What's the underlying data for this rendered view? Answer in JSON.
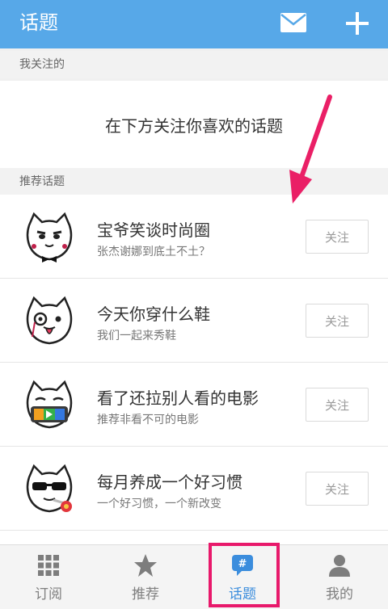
{
  "header": {
    "title": "话题",
    "mail_icon": "mail-icon",
    "add_icon": "plus-icon"
  },
  "following": {
    "label": "我关注的",
    "empty_message": "在下方关注你喜欢的话题"
  },
  "recommended": {
    "label": "推荐话题",
    "follow_label": "关注",
    "topics": [
      {
        "name": "宝爷笑谈时尚圈",
        "desc": "张杰谢娜到底土不土？",
        "avatar_icon": "cat-bowtie-avatar-icon"
      },
      {
        "name": "今天你穿什么鞋",
        "desc": "我们一起来秀鞋",
        "avatar_icon": "cat-monocle-avatar-icon"
      },
      {
        "name": "看了还拉别人看的电影",
        "desc": "推荐非看不可的电影",
        "avatar_icon": "cat-play-avatar-icon"
      },
      {
        "name": "每月养成一个好习惯",
        "desc": "一个好习惯，一个新改变",
        "avatar_icon": "cat-sunglasses-avatar-icon"
      }
    ]
  },
  "tabs": [
    {
      "label": "订阅",
      "icon": "grid-icon",
      "active": false
    },
    {
      "label": "推荐",
      "icon": "star-icon",
      "active": false
    },
    {
      "label": "话题",
      "icon": "topic-bubble-icon",
      "active": true
    },
    {
      "label": "我的",
      "icon": "person-icon",
      "active": false
    }
  ],
  "colors": {
    "header": "#57a8e8",
    "active_tab": "#3b8ddd",
    "highlight": "#e8196b"
  }
}
